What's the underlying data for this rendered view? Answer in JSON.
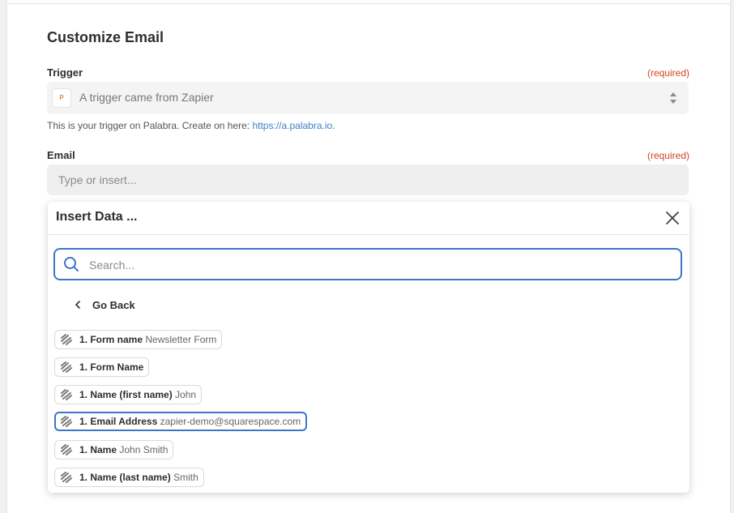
{
  "header": {
    "title": "Customize Email"
  },
  "trigger": {
    "label": "Trigger",
    "required": "(required)",
    "app_icon_text": "P",
    "value": "A trigger came from Zapier",
    "helper_text": "This is your trigger on Palabra. Create on here:",
    "helper_link": "https://a.palabra.io",
    "helper_end": "."
  },
  "email": {
    "label": "Email",
    "required": "(required)",
    "placeholder": "Type or insert..."
  },
  "insert_data": {
    "title": "Insert Data ...",
    "close_icon": "close-icon",
    "search_placeholder": "Search...",
    "go_back_label": "Go Back",
    "items": [
      {
        "key": "1. Form name",
        "value": "Newsletter Form"
      },
      {
        "key": "1. Form Name",
        "value": ""
      },
      {
        "key": "1. Name (first name)",
        "value": "John"
      },
      {
        "key": "1. Email Address",
        "value": "zapier-demo@squarespace.com"
      },
      {
        "key": "1. Name",
        "value": "John Smith"
      },
      {
        "key": "1. Name (last name)",
        "value": "Smith"
      }
    ]
  },
  "colors": {
    "accent": "#3e74c9",
    "required": "#d1451f",
    "link": "#3d7fc4"
  }
}
